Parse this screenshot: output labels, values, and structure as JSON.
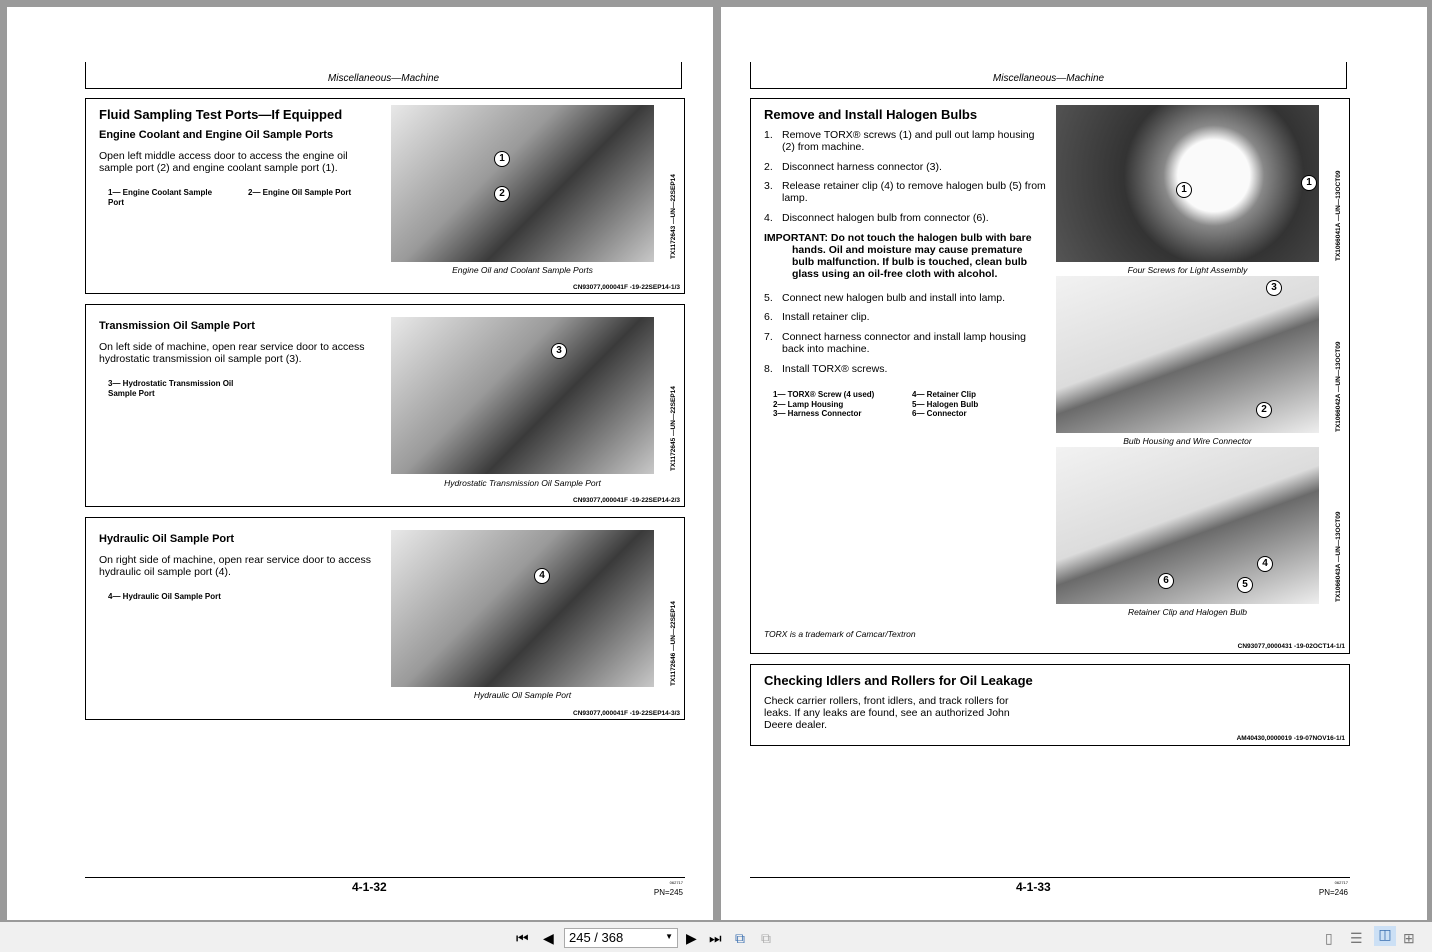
{
  "left_page": {
    "header": "Miscellaneous—Machine",
    "sections": [
      {
        "title": "Fluid Sampling Test Ports—If Equipped",
        "subtitle": "Engine Coolant and Engine Oil Sample Ports",
        "body": "Open left middle access door to access the engine oil sample port (2) and engine coolant sample port (1).",
        "legend": [
          "1— Engine Coolant Sample Port",
          "2— Engine Oil Sample Port"
        ],
        "caption": "Engine Oil and Coolant Sample Ports",
        "image_id": "TX1172643 —UN—22SEP14",
        "code": "CN93077,000041F -19-22SEP14-1/3",
        "callouts": [
          "1",
          "2"
        ]
      },
      {
        "title": "Transmission Oil Sample Port",
        "body": "On left side of machine, open rear service door to access hydrostatic transmission oil sample port (3).",
        "legend": [
          "3— Hydrostatic Transmission Oil Sample Port"
        ],
        "caption": "Hydrostatic Transmission Oil Sample Port",
        "image_id": "TX1172645 —UN—22SEP14",
        "code": "CN93077,000041F -19-22SEP14-2/3",
        "callouts": [
          "3"
        ]
      },
      {
        "title": "Hydraulic Oil Sample Port",
        "body": "On right side of machine, open rear service door to access hydraulic oil sample port (4).",
        "legend": [
          "4— Hydraulic Oil Sample Port"
        ],
        "caption": "Hydraulic Oil Sample Port",
        "image_id": "TX1172646 —UN—22SEP14",
        "code": "CN93077,000041F -19-22SEP14-3/3",
        "callouts": [
          "4"
        ]
      }
    ],
    "page_number": "4-1-32",
    "small_code": "062717",
    "pn": "PN=245"
  },
  "right_page": {
    "header": "Miscellaneous—Machine",
    "section1": {
      "title": "Remove and Install Halogen Bulbs",
      "steps1": [
        {
          "n": "1.",
          "t": "Remove TORX® screws (1) and pull out lamp housing (2) from machine."
        },
        {
          "n": "2.",
          "t": "Disconnect harness connector (3)."
        },
        {
          "n": "3.",
          "t": "Release retainer clip (4) to remove halogen bulb (5) from lamp."
        },
        {
          "n": "4.",
          "t": "Disconnect halogen bulb from connector (6)."
        }
      ],
      "important": "IMPORTANT: Do not touch the halogen bulb with bare hands. Oil and moisture may cause premature bulb malfunction. If bulb is touched, clean bulb glass using an oil-free cloth with alcohol.",
      "steps2": [
        {
          "n": "5.",
          "t": "Connect new halogen bulb and install into lamp."
        },
        {
          "n": "6.",
          "t": "Install retainer clip."
        },
        {
          "n": "7.",
          "t": "Connect harness connector and install lamp housing back into machine."
        },
        {
          "n": "8.",
          "t": "Install TORX® screws."
        }
      ],
      "legend_col1": [
        "1— TORX® Screw (4 used)",
        "2— Lamp Housing",
        "3— Harness Connector"
      ],
      "legend_col2": [
        "4— Retainer Clip",
        "5— Halogen Bulb",
        "6— Connector"
      ],
      "images": [
        {
          "caption": "Four Screws for Light Assembly",
          "image_id": "TX1066041A —UN—13OCT09",
          "callouts": [
            "1",
            "1"
          ]
        },
        {
          "caption": "Bulb Housing and Wire Connector",
          "image_id": "TX1066042A —UN—13OCT09",
          "callouts": [
            "3",
            "2"
          ]
        },
        {
          "caption": "Retainer Clip and Halogen Bulb",
          "image_id": "TX1066043A —UN—13OCT09",
          "callouts": [
            "4",
            "5",
            "6"
          ]
        }
      ],
      "trademark": "TORX is a trademark of Camcar/Textron",
      "code": "CN93077,0000431 -19-02OCT14-1/1"
    },
    "section2": {
      "title": "Checking Idlers and Rollers for Oil Leakage",
      "body": "Check carrier rollers, front idlers, and track rollers for leaks. If any leaks are found, see an authorized John Deere dealer.",
      "code": "AM40430,0000019 -19-07NOV16-1/1"
    },
    "page_number": "4-1-33",
    "small_code": "062717",
    "pn": "PN=246"
  },
  "toolbar": {
    "page_display": "245 / 368",
    "current_page": 245,
    "total_pages": 368
  }
}
